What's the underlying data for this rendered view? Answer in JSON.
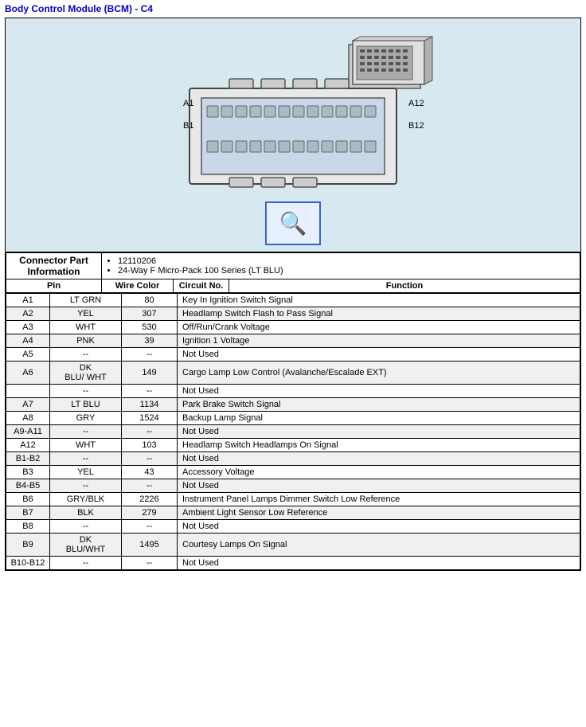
{
  "title": "Body Control Module (BCM) - C4",
  "connector_info_label": "Connector Part Information",
  "part_numbers": [
    "12110206",
    "24-Way F Micro-Pack 100 Series (LT BLU)"
  ],
  "magnifier_icon": "🔍",
  "table_headers": {
    "pin": "Pin",
    "wire_color": "Wire Color",
    "circuit_no": "Circuit No.",
    "function": "Function"
  },
  "rows": [
    {
      "pin": "A1",
      "wire_color": "LT GRN",
      "circuit_no": "80",
      "function": "Key In Ignition Switch Signal"
    },
    {
      "pin": "A2",
      "wire_color": "YEL",
      "circuit_no": "307",
      "function": "Headlamp Switch Flash to Pass Signal"
    },
    {
      "pin": "A3",
      "wire_color": "WHT",
      "circuit_no": "530",
      "function": "Off/Run/Crank Voltage"
    },
    {
      "pin": "A4",
      "wire_color": "PNK",
      "circuit_no": "39",
      "function": "Ignition 1 Voltage"
    },
    {
      "pin": "A5",
      "wire_color": "--",
      "circuit_no": "--",
      "function": "Not Used"
    },
    {
      "pin": "A6",
      "wire_color": "DK BLU/ WHT",
      "circuit_no": "149",
      "function": "Cargo Lamp Low Control (Avalanche/Escalade EXT)",
      "multirow": true
    },
    {
      "pin": "",
      "wire_color": "--",
      "circuit_no": "--",
      "function": "Not Used",
      "extra": true
    },
    {
      "pin": "A7",
      "wire_color": "LT BLU",
      "circuit_no": "1134",
      "function": "Park Brake Switch Signal"
    },
    {
      "pin": "A8",
      "wire_color": "GRY",
      "circuit_no": "1524",
      "function": "Backup Lamp Signal"
    },
    {
      "pin": "A9-A11",
      "wire_color": "--",
      "circuit_no": "--",
      "function": "Not Used"
    },
    {
      "pin": "A12",
      "wire_color": "WHT",
      "circuit_no": "103",
      "function": "Headlamp Switch Headlamps On Signal"
    },
    {
      "pin": "B1-B2",
      "wire_color": "--",
      "circuit_no": "--",
      "function": "Not Used"
    },
    {
      "pin": "B3",
      "wire_color": "YEL",
      "circuit_no": "43",
      "function": "Accessory Voltage"
    },
    {
      "pin": "B4-B5",
      "wire_color": "--",
      "circuit_no": "--",
      "function": "Not Used"
    },
    {
      "pin": "B6",
      "wire_color": "GRY/BLK",
      "circuit_no": "2226",
      "function": "Instrument Panel Lamps Dimmer Switch Low Reference"
    },
    {
      "pin": "B7",
      "wire_color": "BLK",
      "circuit_no": "279",
      "function": "Ambient Light Sensor Low Reference"
    },
    {
      "pin": "B8",
      "wire_color": "--",
      "circuit_no": "--",
      "function": "Not Used"
    },
    {
      "pin": "B9",
      "wire_color": "DK BLU/WHT",
      "circuit_no": "1495",
      "function": "Courtesy Lamps On Signal"
    },
    {
      "pin": "B10-B12",
      "wire_color": "--",
      "circuit_no": "--",
      "function": "Not Used"
    }
  ]
}
